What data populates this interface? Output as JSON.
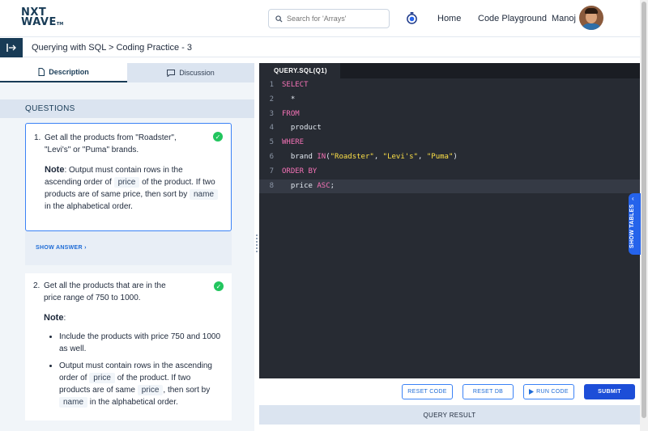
{
  "header": {
    "logo_line1": "NXT",
    "logo_line2": "WAVE",
    "logo_tm": "TM",
    "search_placeholder": "Search for 'Arrays'",
    "nav": [
      "Home",
      "Code Playground"
    ],
    "user_name": "Manoj"
  },
  "breadcrumb": "Querying with SQL > Coding Practice - 3",
  "left_tabs": [
    "Description",
    "Discussion"
  ],
  "questions_heading": "QUESTIONS",
  "questions": [
    {
      "number": "1.",
      "text": "Get all the products from \"Roadster\", \"Levi's\" or \"Puma\" brands.",
      "note_label": "Note",
      "note_before": ": Output must contain rows in the ascending order of",
      "chip1": "price",
      "note_middle": "of the product. If two products are of same price, then sort by",
      "chip2": "name",
      "note_after": "in the alphabetical order.",
      "show_answer": "SHOW ANSWER"
    },
    {
      "number": "2.",
      "text": "Get all the products that are in the price range of 750 to 1000.",
      "note_label": "Note",
      "note_colon": ":",
      "bullet1": "Include the products with price 750 and 1000 as well.",
      "bullet2_before": "Output must contain rows in the ascending order of",
      "chip1": "price",
      "bullet2_middle": "of the product. If two products are of same",
      "chip2": "price",
      "bullet2_middle2": ", then sort by",
      "chip3": "name",
      "bullet2_after": "in the alphabetical order."
    }
  ],
  "editor": {
    "file_tab": "QUERY.SQL(Q1)",
    "line_numbers": [
      "1",
      "2",
      "3",
      "4",
      "5",
      "6",
      "7",
      "8"
    ],
    "l1": "SELECT",
    "l2": "*",
    "l3": "FROM",
    "l4": "product",
    "l5": "WHERE",
    "l6_a": "brand ",
    "l6_in": "IN",
    "l6_b": "(",
    "l6_s1": "\"Roadster\"",
    "l6_c1": ", ",
    "l6_s2": "\"Levi's\"",
    "l6_c2": ", ",
    "l6_s3": "\"Puma\"",
    "l6_e": ")",
    "l7": "ORDER BY",
    "l8_a": "price ",
    "l8_asc": "ASC",
    "l8_e": ";"
  },
  "show_tables": "SHOW TABLES",
  "buttons": {
    "reset_code": "RESET CODE",
    "reset_db": "RESET DB",
    "run_code": "RUN CODE",
    "submit": "SUBMIT"
  },
  "query_result": "QUERY RESULT",
  "colors": {
    "brand_navy": "#183b56",
    "accent_blue": "#1d4ed8",
    "success_green": "#22c55e",
    "editor_bg": "#272b33",
    "keyword_pink": "#f472b6",
    "string_yellow": "#fde047"
  },
  "icons": [
    "search-icon",
    "timer-icon",
    "sidebar-toggle-icon",
    "description-icon",
    "discussion-icon",
    "check-icon",
    "chevron-right-icon",
    "play-icon",
    "chevron-up-icon"
  ]
}
